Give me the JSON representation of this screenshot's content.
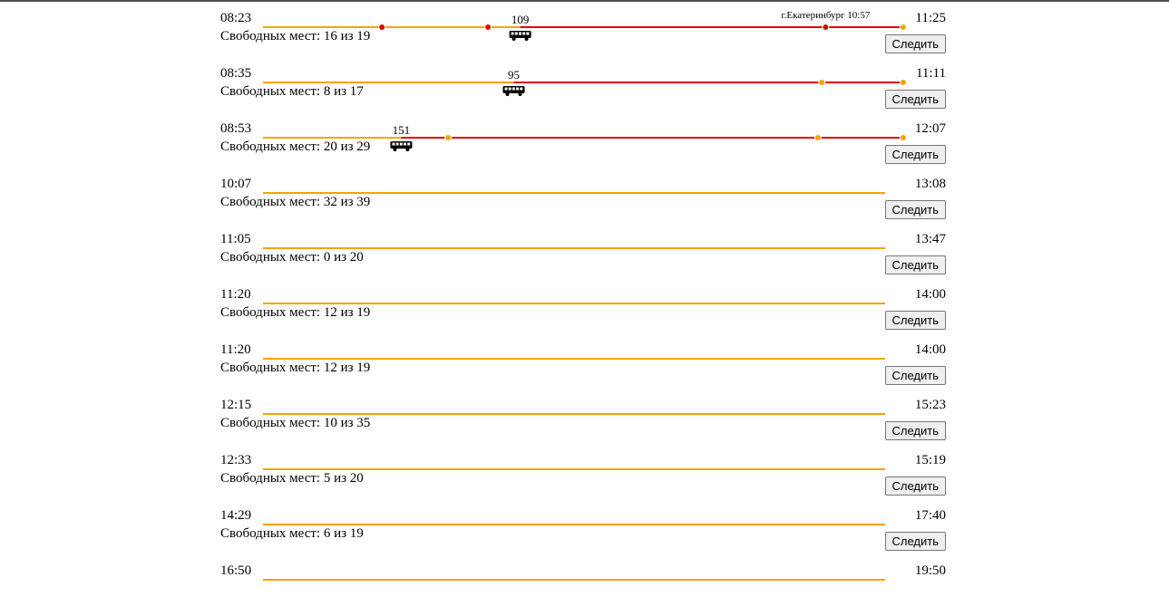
{
  "colors": {
    "upcoming": "#f5a400",
    "traveled": "#e00000",
    "text": "#000000"
  },
  "follow_label": "Следить",
  "trips": [
    {
      "dep": "08:23",
      "arr": "11:25",
      "seats": "Свободных мест: 16 из 19",
      "bus_number": "109",
      "progress": 0.4,
      "stops": [
        {
          "pos": 0.185,
          "passed": true
        },
        {
          "pos": 0.35,
          "passed": true
        },
        {
          "pos": 0.875,
          "passed": true,
          "label": "г.Екатеринбург 10:57"
        },
        {
          "pos": 1.0,
          "passed": false
        }
      ]
    },
    {
      "dep": "08:35",
      "arr": "11:11",
      "seats": "Свободных мест: 8 из 17",
      "bus_number": "95",
      "progress": 0.39,
      "stops": [
        {
          "pos": 0.869,
          "passed": false
        },
        {
          "pos": 1.0,
          "passed": false
        }
      ]
    },
    {
      "dep": "08:53",
      "arr": "12:07",
      "seats": "Свободных мест: 20 из 29",
      "bus_number": "151",
      "progress": 0.215,
      "stops": [
        {
          "pos": 0.288,
          "passed": false
        },
        {
          "pos": 0.863,
          "passed": false
        },
        {
          "pos": 1.0,
          "passed": false
        }
      ]
    },
    {
      "dep": "10:07",
      "arr": "13:08",
      "seats": "Свободных мест: 32 из 39"
    },
    {
      "dep": "11:05",
      "arr": "13:47",
      "seats": "Свободных мест: 0 из 20"
    },
    {
      "dep": "11:20",
      "arr": "14:00",
      "seats": "Свободных мест: 12 из 19"
    },
    {
      "dep": "11:20",
      "arr": "14:00",
      "seats": "Свободных мест: 12 из 19"
    },
    {
      "dep": "12:15",
      "arr": "15:23",
      "seats": "Свободных мест: 10 из 35"
    },
    {
      "dep": "12:33",
      "arr": "15:19",
      "seats": "Свободных мест: 5 из 20"
    },
    {
      "dep": "14:29",
      "arr": "17:40",
      "seats": "Свободных мест: 6 из 19"
    },
    {
      "dep": "16:50",
      "arr": "19:50"
    }
  ]
}
